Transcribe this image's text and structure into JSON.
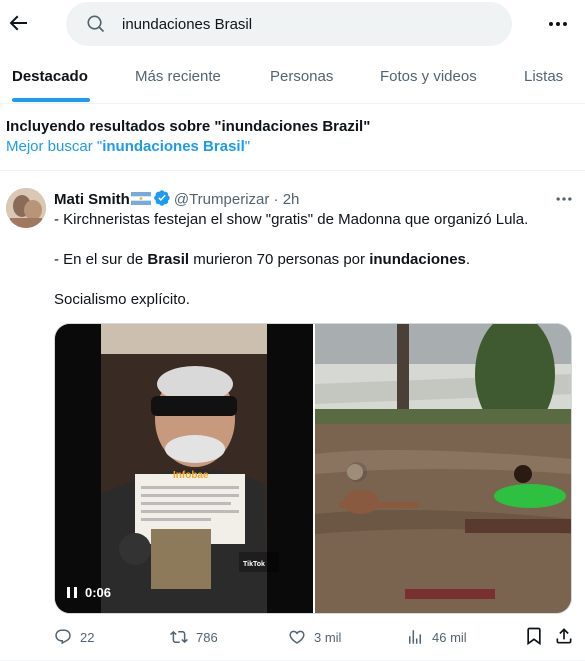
{
  "search": {
    "query": "inundaciones Brasil"
  },
  "tabs": [
    {
      "label": "Destacado"
    },
    {
      "label": "Más reciente"
    },
    {
      "label": "Personas"
    },
    {
      "label": "Fotos y videos"
    },
    {
      "label": "Listas"
    }
  ],
  "spelling": {
    "including": "Incluyendo resultados sobre \"inundaciones Brazil\"",
    "prefix": "Mejor buscar ",
    "quote_open": "\"",
    "suggestion": "inundaciones Brasil",
    "quote_close": "\""
  },
  "tweet": {
    "name": "Mati Smith",
    "handle": "@Trumperizar",
    "separator": "·",
    "time": "2h",
    "line1": "- Kirchneristas festejan el show \"gratis\" de Madonna que organizó Lula.",
    "line2_a": "- En el sur de ",
    "line2_b": "Brasil",
    "line2_c": " murieron 70 personas por ",
    "line2_d": "inundaciones",
    "line2_e": ".",
    "line3": "Socialismo explícito.",
    "media": {
      "video_time": "0:06",
      "video_source_label": "Infobae",
      "video_watermark": "TikTok"
    },
    "stats": {
      "replies": "22",
      "reposts": "786",
      "likes": "3 mil",
      "views": "46 mil"
    }
  },
  "icons": {
    "back": "arrow-left-icon",
    "search": "search-icon",
    "more": "more-horizontal-icon",
    "verified": "verified-badge-icon",
    "flag": "argentina-flag-icon",
    "reply": "reply-icon",
    "repost": "repost-icon",
    "like": "heart-icon",
    "views": "views-icon",
    "bookmark": "bookmark-icon",
    "share": "share-icon"
  },
  "colors": {
    "accent": "#1d9bf0",
    "text": "#0f1419",
    "secondary": "#536471",
    "search_bg": "#eff3f4"
  }
}
